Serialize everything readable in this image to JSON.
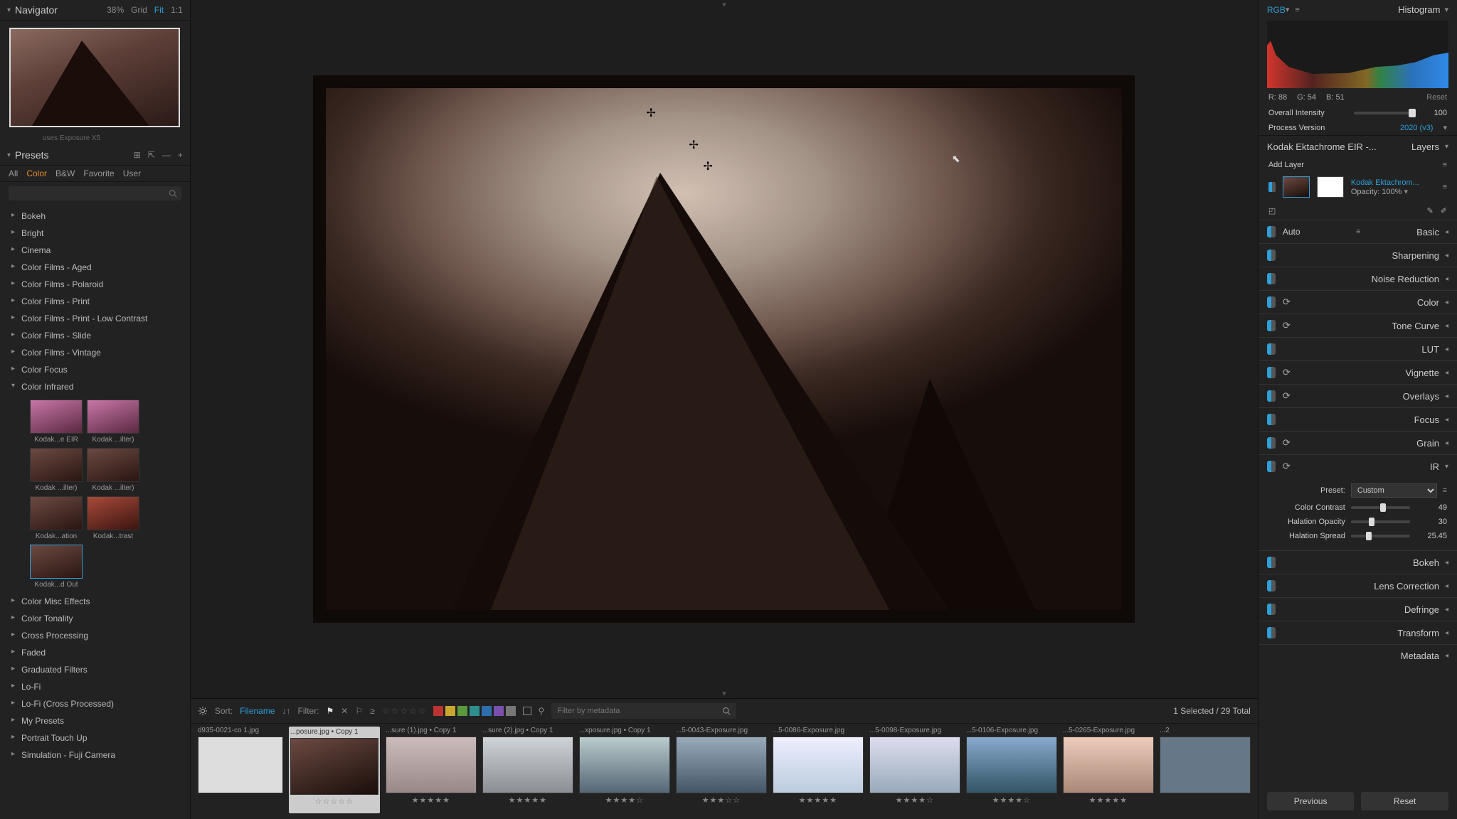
{
  "navigator": {
    "title": "Navigator",
    "zoom": "38%",
    "grid": "Grid",
    "fit": "Fit",
    "one": "1:1",
    "stray": "uses Exposure X5"
  },
  "presets": {
    "title": "Presets",
    "tabs": [
      "All",
      "Color",
      "B&W",
      "Favorite",
      "User"
    ],
    "tab_active": 1,
    "cats_top": [
      "Bokeh",
      "Bright",
      "Cinema",
      "Color Films - Aged",
      "Color Films - Polaroid",
      "Color Films - Print",
      "Color Films - Print - Low Contrast",
      "Color Films - Slide",
      "Color Films - Vintage",
      "Color Focus"
    ],
    "open_cat": "Color Infrared",
    "thumbs": [
      {
        "lbl": "Kodak...e EIR",
        "v": "pink"
      },
      {
        "lbl": "Kodak ...ilter)",
        "v": "pink"
      },
      {
        "lbl": "Kodak ...ilter)",
        "v": ""
      },
      {
        "lbl": "Kodak ...ilter)",
        "v": ""
      },
      {
        "lbl": "Kodak...ation",
        "v": ""
      },
      {
        "lbl": "Kodak...trast",
        "v": "red"
      },
      {
        "lbl": "Kodak...d Out",
        "v": "",
        "sel": true
      }
    ],
    "cats_bottom": [
      "Color Misc Effects",
      "Color Tonality",
      "Cross Processing",
      "Faded",
      "Graduated Filters",
      "Lo-Fi",
      "Lo-Fi (Cross Processed)",
      "My Presets",
      "Portrait Touch Up",
      "Simulation - Fuji Camera"
    ]
  },
  "filmstrip": {
    "sort_label": "Sort:",
    "sort_value": "Filename",
    "filter_label": "Filter:",
    "meta_placeholder": "Filter by metadata",
    "selected": "1 Selected / 29 Total",
    "swatches": [
      "#b33",
      "#c9a82f",
      "#5a9a3d",
      "#2f8f8f",
      "#2f6fae",
      "#7b4fae",
      "#777"
    ],
    "thumbs": [
      {
        "name": "d935-0021-co 1.jpg",
        "rating": "",
        "bg": "#ddd",
        "first": true
      },
      {
        "name": "...posure.jpg • Copy 1",
        "rating": "☆☆☆☆☆",
        "bg": "linear-gradient(160deg,#6b4a42,#1a0d0a)",
        "sel": true
      },
      {
        "name": "...sure (1).jpg • Copy 1",
        "rating": "★★★★★",
        "bg": "linear-gradient(#cbb,#988)"
      },
      {
        "name": "...sure (2).jpg • Copy 1",
        "rating": "★★★★★",
        "bg": "linear-gradient(#cfd4d8,#8a8e92)"
      },
      {
        "name": "...xposure.jpg • Copy 1",
        "rating": "★★★★☆",
        "bg": "linear-gradient(#bcc,#567)"
      },
      {
        "name": "...5-0043-Exposure.jpg",
        "rating": "★★★☆☆",
        "bg": "linear-gradient(#9ab,#456)"
      },
      {
        "name": "...5-0086-Exposure.jpg",
        "rating": "★★★★★",
        "bg": "linear-gradient(#eef,#bcd)"
      },
      {
        "name": "...5-0098-Exposure.jpg",
        "rating": "★★★★☆",
        "bg": "linear-gradient(#dde,#9ab)"
      },
      {
        "name": "...5-0106-Exposure.jpg",
        "rating": "★★★★☆",
        "bg": "linear-gradient(#8ac,#356)"
      },
      {
        "name": "...5-0265-Exposure.jpg",
        "rating": "★★★★★",
        "bg": "linear-gradient(#ecb,#a87)"
      },
      {
        "name": "...2",
        "rating": "",
        "bg": "#678"
      }
    ]
  },
  "right": {
    "rgb": "RGB",
    "histogram": "Histogram",
    "read": {
      "r": "R: 88",
      "g": "G: 54",
      "b": "B: 51",
      "reset": "Reset"
    },
    "overall": {
      "lbl": "Overall Intensity",
      "val": "100",
      "pos": 97
    },
    "pv": {
      "lbl": "Process Version",
      "val": "2020 (v3)"
    },
    "layerfile": "Kodak Ektachrome EIR -...",
    "layers": "Layers",
    "addlayer": "Add Layer",
    "layer": {
      "name": "Kodak Ektachrom...",
      "opacity_lbl": "Opacity:",
      "opacity": "100%"
    },
    "adjust": [
      {
        "nm": "Basic",
        "auto": "Auto",
        "reset": false
      },
      {
        "nm": "Sharpening",
        "reset": false
      },
      {
        "nm": "Noise Reduction",
        "reset": false
      },
      {
        "nm": "Color",
        "reset": true
      },
      {
        "nm": "Tone Curve",
        "reset": true
      },
      {
        "nm": "LUT",
        "reset": false
      },
      {
        "nm": "Vignette",
        "reset": true
      },
      {
        "nm": "Overlays",
        "reset": true
      },
      {
        "nm": "Focus",
        "reset": false
      },
      {
        "nm": "Grain",
        "reset": true
      }
    ],
    "ir": {
      "nm": "IR",
      "preset_lbl": "Preset:",
      "preset_val": "Custom",
      "sliders": [
        {
          "lbl": "Color Contrast",
          "val": "49",
          "pos": 49
        },
        {
          "lbl": "Halation Opacity",
          "val": "30",
          "pos": 30
        },
        {
          "lbl": "Halation Spread",
          "val": "25.45",
          "pos": 25
        }
      ]
    },
    "adjust2": [
      {
        "nm": "Bokeh",
        "reset": false
      },
      {
        "nm": "Lens Correction",
        "reset": false
      },
      {
        "nm": "Defringe",
        "reset": false
      },
      {
        "nm": "Transform",
        "reset": false
      },
      {
        "nm": "Metadata",
        "reset": false,
        "nopill": true
      }
    ],
    "prev": "Previous",
    "reset": "Reset"
  }
}
